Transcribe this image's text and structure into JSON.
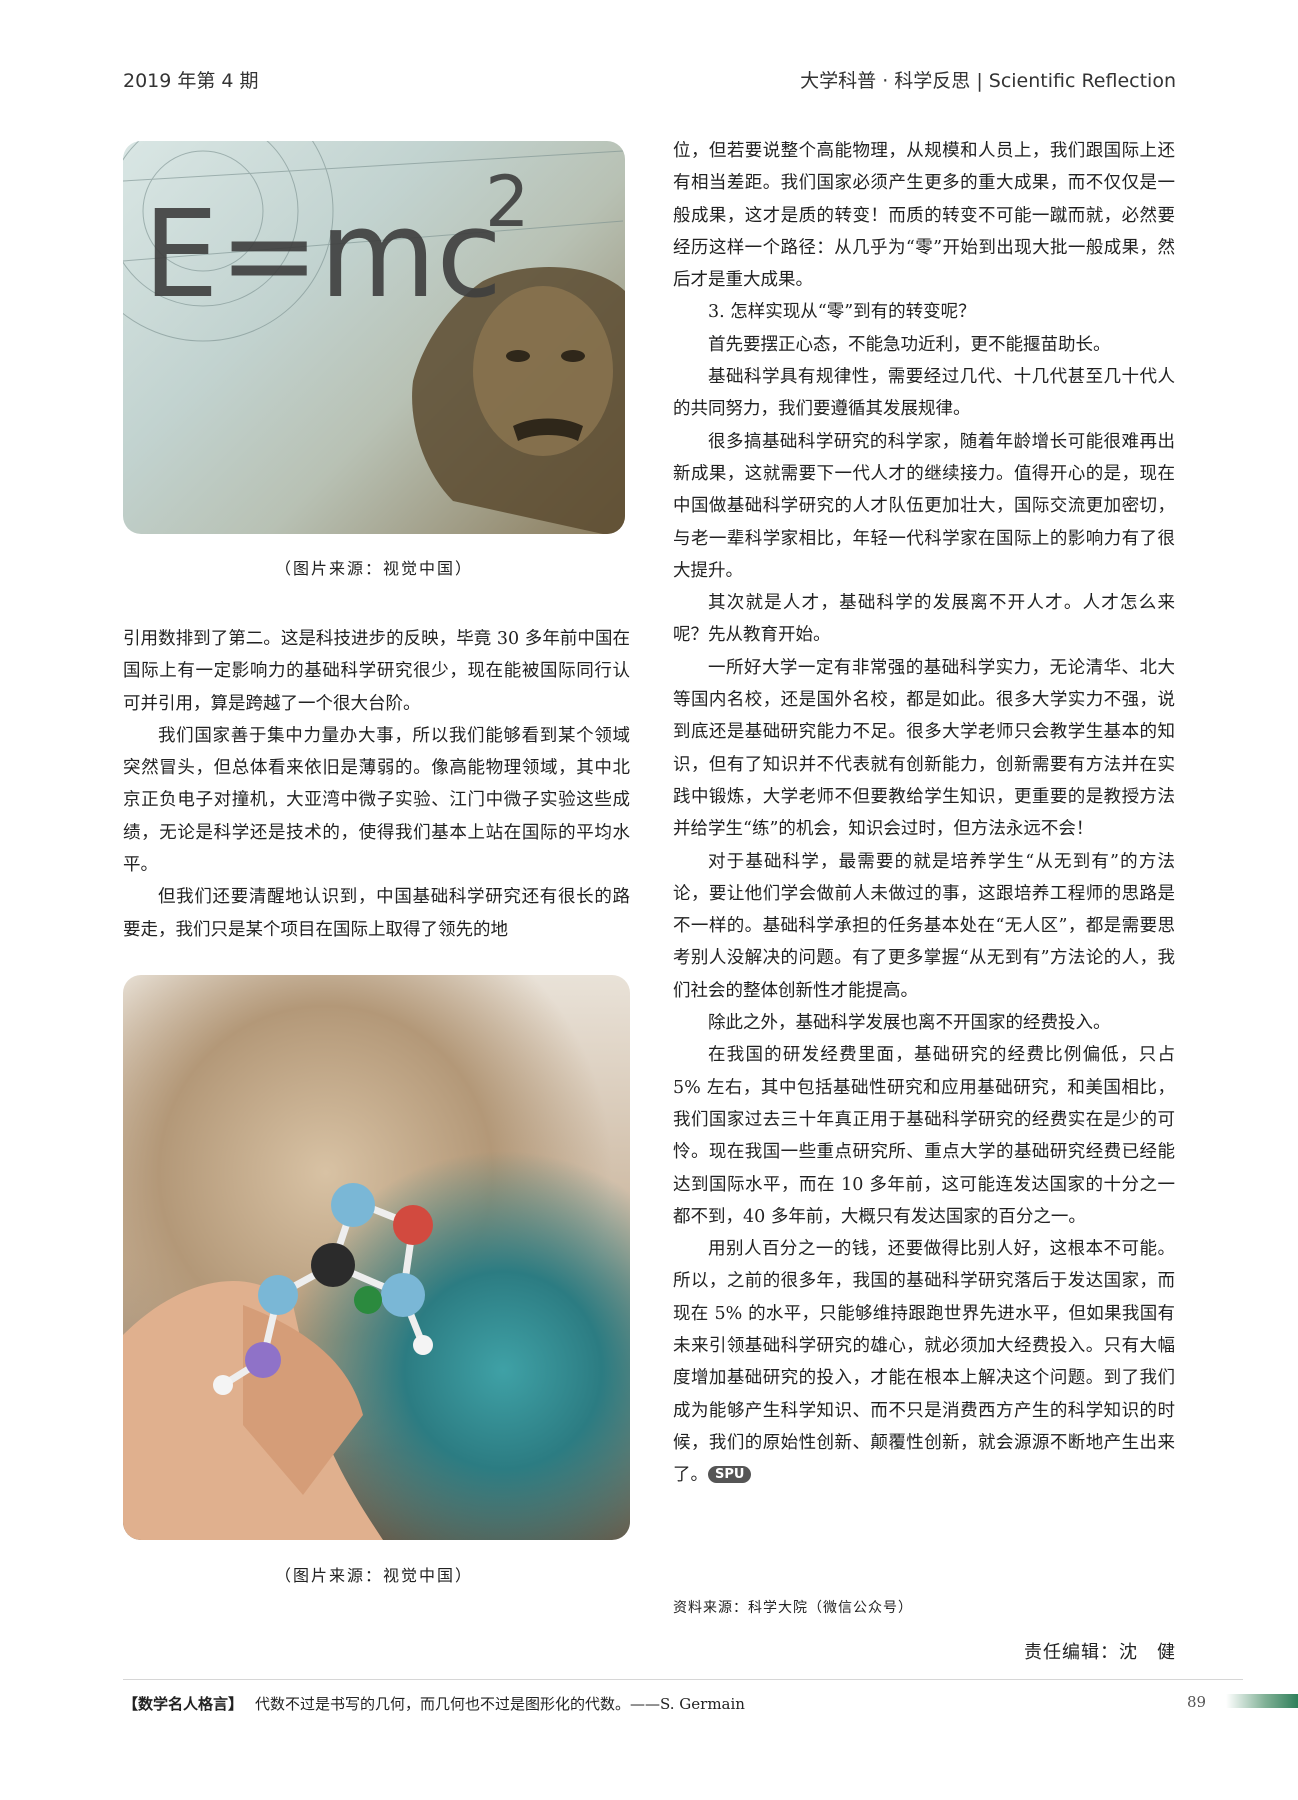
{
  "header": {
    "issue": "2019 年第 4 期",
    "section": "大学科普 · 科学反思 | Scientific Reflection"
  },
  "figures": [
    {
      "name": "einstein-emc2-image",
      "caption": "（图片来源：视觉中国）"
    },
    {
      "name": "molecule-model-image",
      "caption": "（图片来源：视觉中国）"
    }
  ],
  "left_column": [
    "引用数排到了第二。这是科技进步的反映，毕竟 30 多年前中国在国际上有一定影响力的基础科学研究很少，现在能被国际同行认可并引用，算是跨越了一个很大台阶。",
    "我们国家善于集中力量办大事，所以我们能够看到某个领域突然冒头，但总体看来依旧是薄弱的。像高能物理领域，其中北京正负电子对撞机，大亚湾中微子实验、江门中微子实验这些成绩，无论是科学还是技术的，使得我们基本上站在国际的平均水平。",
    "但我们还要清醒地认识到，中国基础科学研究还有很长的路要走，我们只是某个项目在国际上取得了领先的地"
  ],
  "right_column": [
    "位，但若要说整个高能物理，从规模和人员上，我们跟国际上还有相当差距。我们国家必须产生更多的重大成果，而不仅仅是一般成果，这才是质的转变！而质的转变不可能一蹴而就，必然要经历这样一个路径：从几乎为“零”开始到出现大批一般成果，然后才是重大成果。",
    "3. 怎样实现从“零”到有的转变呢？",
    "首先要摆正心态，不能急功近利，更不能揠苗助长。",
    "基础科学具有规律性，需要经过几代、十几代甚至几十代人的共同努力，我们要遵循其发展规律。",
    "很多搞基础科学研究的科学家，随着年龄增长可能很难再出新成果，这就需要下一代人才的继续接力。值得开心的是，现在中国做基础科学研究的人才队伍更加壮大，国际交流更加密切，与老一辈科学家相比，年轻一代科学家在国际上的影响力有了很大提升。",
    "其次就是人才，基础科学的发展离不开人才。人才怎么来呢？先从教育开始。",
    "一所好大学一定有非常强的基础科学实力，无论清华、北大等国内名校，还是国外名校，都是如此。很多大学实力不强，说到底还是基础研究能力不足。很多大学老师只会教学生基本的知识，但有了知识并不代表就有创新能力，创新需要有方法并在实践中锻炼，大学老师不但要教给学生知识，更重要的是教授方法并给学生“练”的机会，知识会过时，但方法永远不会！",
    "对于基础科学，最需要的就是培养学生“从无到有”的方法论，要让他们学会做前人未做过的事，这跟培养工程师的思路是不一样的。基础科学承担的任务基本处在“无人区”，都是需要思考别人没解决的问题。有了更多掌握“从无到有”方法论的人，我们社会的整体创新性才能提高。",
    "除此之外，基础科学发展也离不开国家的经费投入。",
    "在我国的研发经费里面，基础研究的经费比例偏低，只占 5% 左右，其中包括基础性研究和应用基础研究，和美国相比，我们国家过去三十年真正用于基础科学研究的经费实在是少的可怜。现在我国一些重点研究所、重点大学的基础研究经费已经能达到国际水平，而在 10 多年前，这可能连发达国家的十分之一都不到，40 多年前，大概只有发达国家的百分之一。",
    "用别人百分之一的钱，还要做得比别人好，这根本不可能。所以，之前的很多年，我国的基础科学研究落后于发达国家，而现在 5% 的水平，只能够维持跟跑世界先进水平，但如果我国有未来引领基础科学研究的雄心，就必须加大经费投入。只有大幅度增加基础研究的投入，才能在根本上解决这个问题。到了我们成为能够产生科学知识、而不只是消费西方产生的科学知识的时候，我们的原始性创新、颠覆性创新，就会源源不断地产生出来了。"
  ],
  "end_badge": "SPU",
  "source": "资料来源：科学大院（微信公众号）",
  "editor": "责任编辑：沈　健",
  "footer": {
    "tag": "【数学名人格言】",
    "quote": "代数不过是书写的几何，而几何也不过是图形化的代数。——S. Germain",
    "page_number": "89"
  }
}
